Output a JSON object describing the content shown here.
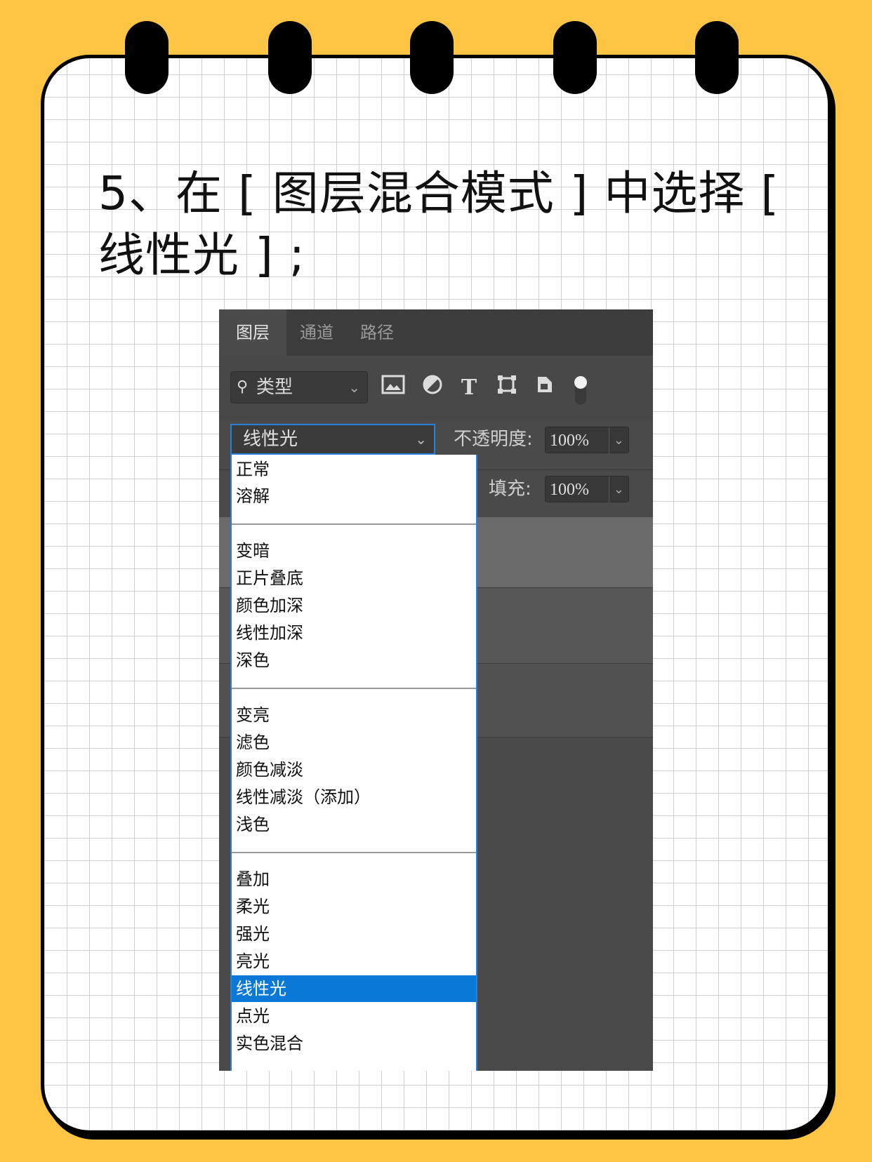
{
  "title": "5、在 [ 图层混合模式 ] 中选择 [ 线性光 ] ;",
  "panel": {
    "tabs": [
      "图层",
      "通道",
      "路径"
    ],
    "active_tab": 0,
    "filter_label": "类型",
    "blend_mode": "线性光",
    "opacity_label": "不透明度:",
    "opacity_value": "100%",
    "fill_label": "填充:",
    "fill_value": "100%",
    "tool_icons": [
      "image-filter-icon",
      "adjustment-filter-icon",
      "type-filter-icon",
      "shape-filter-icon",
      "smart-object-filter-icon",
      "filter-toggle-icon"
    ]
  },
  "dropdown": {
    "groups": [
      [
        "正常",
        "溶解"
      ],
      [
        "变暗",
        "正片叠底",
        "颜色加深",
        "线性加深",
        "深色"
      ],
      [
        "变亮",
        "滤色",
        "颜色减淡",
        "线性减淡（添加）",
        "浅色"
      ],
      [
        "叠加",
        "柔光",
        "强光",
        "亮光",
        "线性光",
        "点光",
        "实色混合"
      ]
    ],
    "selected": "线性光"
  }
}
